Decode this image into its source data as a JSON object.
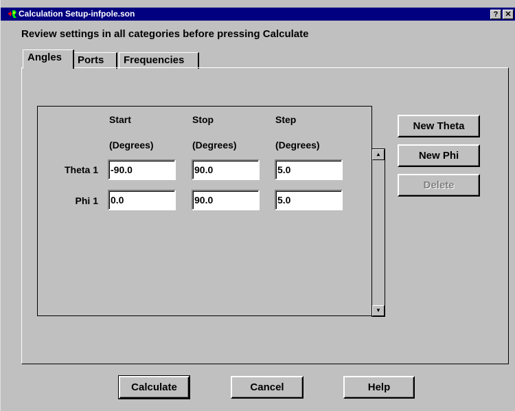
{
  "window": {
    "title": "Calculation Setup-infpole.son",
    "help_btn": "?",
    "close_btn": "✕"
  },
  "instruction": "Review settings in all categories before pressing Calculate",
  "tabs": [
    {
      "label": "Angles",
      "active": true
    },
    {
      "label": "Ports",
      "active": false
    },
    {
      "label": "Frequencies",
      "active": false
    }
  ],
  "angles": {
    "columns": [
      {
        "name": "Start",
        "unit": "(Degrees)"
      },
      {
        "name": "Stop",
        "unit": "(Degrees)"
      },
      {
        "name": "Step",
        "unit": "(Degrees)"
      }
    ],
    "rows": [
      {
        "label": "Theta 1",
        "start": "-90.0",
        "stop": "90.0",
        "step": "5.0"
      },
      {
        "label": "Phi 1",
        "start": "0.0",
        "stop": "90.0",
        "step": "5.0"
      }
    ]
  },
  "side_buttons": {
    "new_theta": "New Theta",
    "new_phi": "New Phi",
    "delete": "Delete",
    "delete_enabled": false
  },
  "scrollbar": {
    "up_icon": "▲",
    "down_icon": "▼"
  },
  "bottom_buttons": {
    "calculate": "Calculate",
    "cancel": "Cancel",
    "help": "Help"
  }
}
